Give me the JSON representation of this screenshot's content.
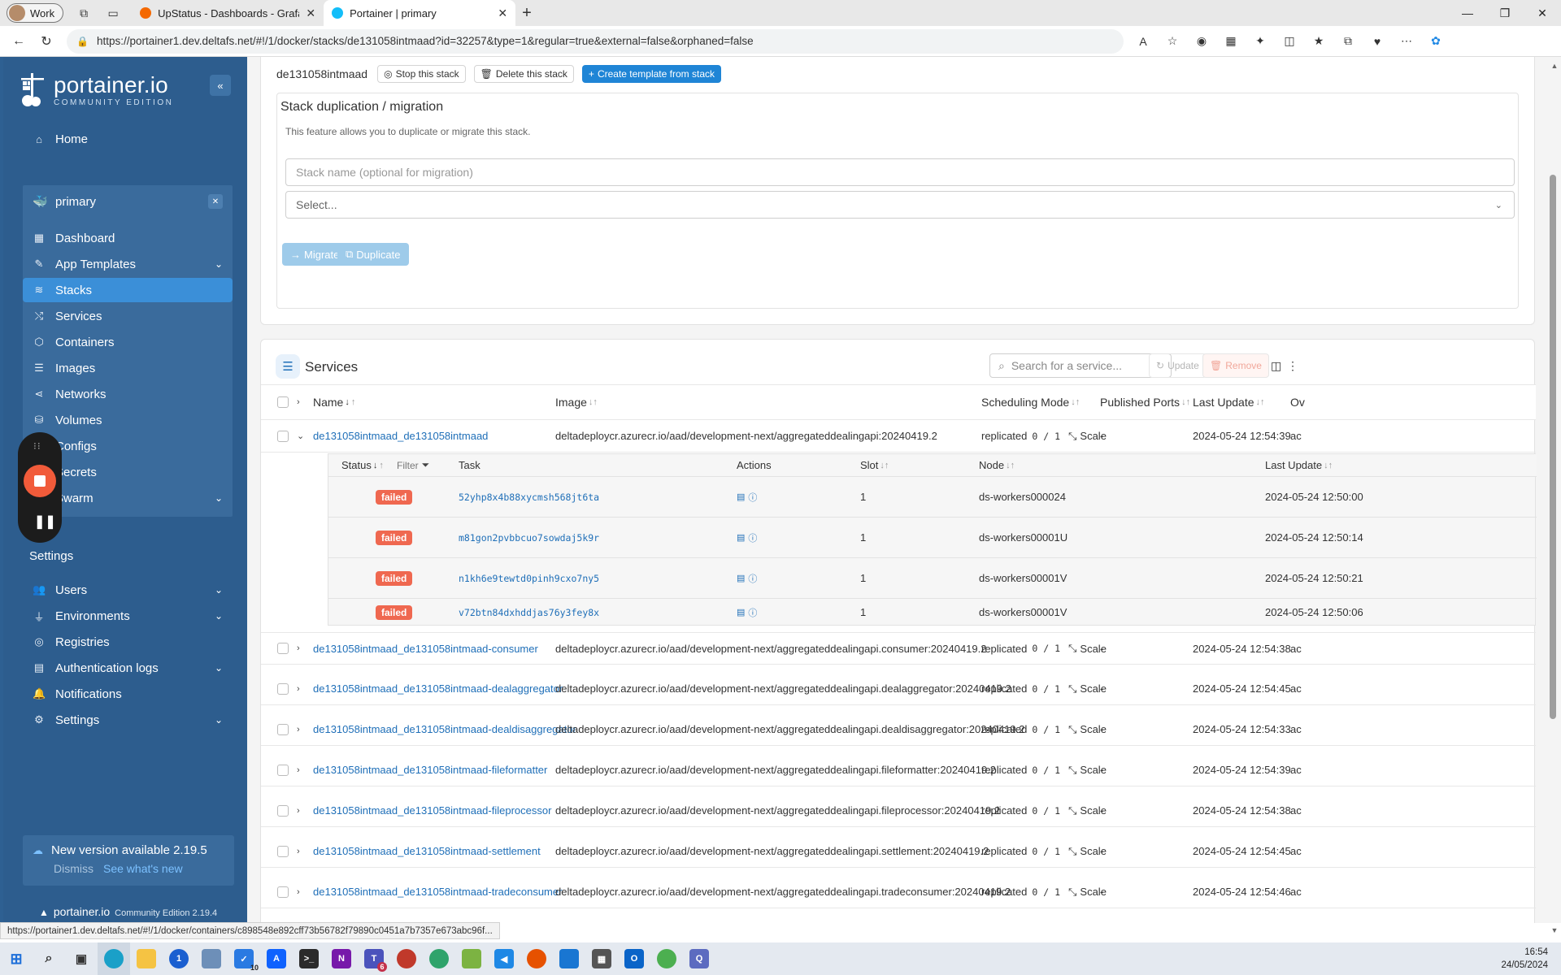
{
  "browser": {
    "profile_label": "Work",
    "tabs": [
      {
        "title": "UpStatus - Dashboards - Grafana",
        "icon": "grafana-icon"
      },
      {
        "title": "Portainer | primary",
        "icon": "portainer-icon"
      }
    ],
    "url": "https://portainer1.dev.deltafs.net/#!/1/docker/stacks/de131058intmaad?id=32257&type=1&regular=true&external=false&orphaned=false"
  },
  "sidebar": {
    "brand": "portainer.io",
    "edition": "COMMUNITY EDITION",
    "home": "Home",
    "environment": "primary",
    "env_items": [
      {
        "label": "Dashboard",
        "icon": "dashboard-icon"
      },
      {
        "label": "App Templates",
        "icon": "edit-icon"
      },
      {
        "label": "Stacks",
        "icon": "stacks-icon"
      },
      {
        "label": "Services",
        "icon": "shuffle-icon"
      },
      {
        "label": "Containers",
        "icon": "box-icon"
      },
      {
        "label": "Images",
        "icon": "list-icon"
      },
      {
        "label": "Networks",
        "icon": "share-icon"
      },
      {
        "label": "Volumes",
        "icon": "database-icon"
      },
      {
        "label": "Configs",
        "icon": "file-icon"
      },
      {
        "label": "Secrets",
        "icon": "lock-icon"
      },
      {
        "label": "Swarm",
        "icon": "cluster-icon"
      }
    ],
    "settings_heading": "Settings",
    "settings_items": [
      {
        "label": "Users",
        "icon": "users-icon"
      },
      {
        "label": "Environments",
        "icon": "plug-icon"
      },
      {
        "label": "Registries",
        "icon": "radio-icon"
      },
      {
        "label": "Authentication logs",
        "icon": "log-icon"
      },
      {
        "label": "Notifications",
        "icon": "bell-icon"
      },
      {
        "label": "Settings",
        "icon": "gear-icon"
      }
    ],
    "update_title": "New version available 2.19.5",
    "update_dismiss": "Dismiss",
    "update_link": "See what's new",
    "footer_brand": "portainer.io",
    "footer_version": "Community Edition 2.19.4"
  },
  "stack": {
    "name": "de131058intmaad",
    "stop": "Stop this stack",
    "delete": "Delete this stack",
    "create_template": "Create template from stack",
    "dup_title": "Stack duplication / migration",
    "dup_desc": "This feature allows you to duplicate or migrate this stack.",
    "name_placeholder": "Stack name (optional for migration)",
    "select_placeholder": "Select...",
    "migrate": "Migrate",
    "duplicate": "Duplicate"
  },
  "services": {
    "title": "Services",
    "search_placeholder": "Search for a service...",
    "update_btn": "Update",
    "remove_btn": "Remove",
    "columns": {
      "name": "Name",
      "image": "Image",
      "scheduling": "Scheduling Mode",
      "ports": "Published Ports",
      "updated": "Last Update",
      "owner": "Ov"
    },
    "scale_label": "Scale",
    "mode": "replicated",
    "rows": [
      {
        "name": "de131058intmaad_de131058intmaad",
        "image": "deltadeploycr.azurecr.io/aad/development-next/aggregateddealingapi:20240419.2",
        "counts": "0 / 1",
        "ports": "-",
        "updated": "2024-05-24 12:54:39",
        "owner": "ac"
      },
      {
        "name": "de131058intmaad_de131058intmaad-consumer",
        "image": "deltadeploycr.azurecr.io/aad/development-next/aggregateddealingapi.consumer:20240419.2",
        "counts": "0 / 1",
        "ports": "-",
        "updated": "2024-05-24 12:54:38",
        "owner": "ac"
      },
      {
        "name": "de131058intmaad_de131058intmaad-dealaggregator",
        "image": "deltadeploycr.azurecr.io/aad/development-next/aggregateddealingapi.dealaggregator:20240419.2",
        "counts": "0 / 1",
        "ports": "-",
        "updated": "2024-05-24 12:54:45",
        "owner": "ac"
      },
      {
        "name": "de131058intmaad_de131058intmaad-dealdisaggregator",
        "image": "deltadeploycr.azurecr.io/aad/development-next/aggregateddealingapi.dealdisaggregator:20240419.2",
        "counts": "0 / 1",
        "ports": "-",
        "updated": "2024-05-24 12:54:33",
        "owner": "ac"
      },
      {
        "name": "de131058intmaad_de131058intmaad-fileformatter",
        "image": "deltadeploycr.azurecr.io/aad/development-next/aggregateddealingapi.fileformatter:20240419.2",
        "counts": "0 / 1",
        "ports": "-",
        "updated": "2024-05-24 12:54:39",
        "owner": "ac"
      },
      {
        "name": "de131058intmaad_de131058intmaad-fileprocessor",
        "image": "deltadeploycr.azurecr.io/aad/development-next/aggregateddealingapi.fileprocessor:20240419.2",
        "counts": "0 / 1",
        "ports": "-",
        "updated": "2024-05-24 12:54:38",
        "owner": "ac"
      },
      {
        "name": "de131058intmaad_de131058intmaad-settlement",
        "image": "deltadeploycr.azurecr.io/aad/development-next/aggregateddealingapi.settlement:20240419.2",
        "counts": "0 / 1",
        "ports": "-",
        "updated": "2024-05-24 12:54:45",
        "owner": "ac"
      },
      {
        "name": "de131058intmaad_de131058intmaad-tradeconsumer",
        "image": "deltadeploycr.azurecr.io/aad/development-next/aggregateddealingapi.tradeconsumer:20240419.2",
        "counts": "0 / 1",
        "ports": "-",
        "updated": "2024-05-24 12:54:46",
        "owner": "ac"
      }
    ]
  },
  "tasks": {
    "columns": {
      "status": "Status",
      "filter": "Filter",
      "task": "Task",
      "actions": "Actions",
      "slot": "Slot",
      "node": "Node",
      "updated": "Last Update"
    },
    "rows": [
      {
        "status": "failed",
        "id": "52yhp8x4b88xycmsh568jt6ta",
        "slot": "1",
        "node": "ds-workers000024",
        "updated": "2024-05-24 12:50:00"
      },
      {
        "status": "failed",
        "id": "m81gon2pvbbcuo7sowdaj5k9r",
        "slot": "1",
        "node": "ds-workers00001U",
        "updated": "2024-05-24 12:50:14"
      },
      {
        "status": "failed",
        "id": "n1kh6e9tewtd0pinh9cxo7ny5",
        "slot": "1",
        "node": "ds-workers00001V",
        "updated": "2024-05-24 12:50:21"
      },
      {
        "status": "failed",
        "id": "v72btn84dxhddjas76y3fey8x",
        "slot": "1",
        "node": "ds-workers00001V",
        "updated": "2024-05-24 12:50:06"
      }
    ]
  },
  "status_bar_url": "https://portainer1.dev.deltafs.net/#!/1/docker/containers/c898548e892cff73b56782f79890c0451a7b7357e673abc96f...",
  "taskbar": {
    "time": "16:54",
    "date": "24/05/2024",
    "teams_badge": "6",
    "todo_badge": "10"
  },
  "colors": {
    "sidebar": "#2d5d8e",
    "active_nav": "#3b8fd8",
    "primary": "#1f85d6",
    "link": "#1f6fb8",
    "failed": "#ef6850"
  }
}
